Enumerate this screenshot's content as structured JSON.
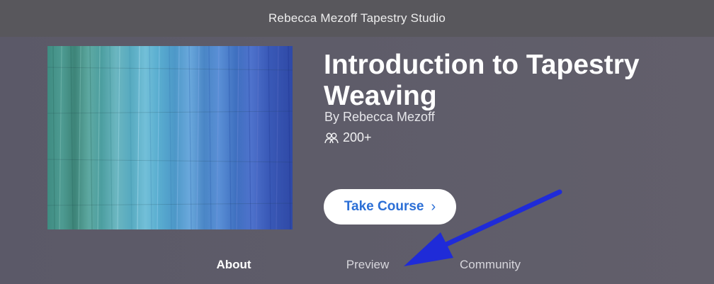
{
  "window": {
    "title": "Rebecca Mezoff Tapestry Studio"
  },
  "course": {
    "title": "Introduction to Tapestry Weaving",
    "author": "By Rebecca Mezoff",
    "participants_icon": "people-icon",
    "participants": "200+",
    "thumbnail": "dyed-yarn-skeins-image"
  },
  "actions": {
    "take_course_label": "Take Course",
    "take_course_icon": "chevron-right-icon"
  },
  "tabs": [
    {
      "label": "About",
      "active": true
    },
    {
      "label": "Preview",
      "active": false
    },
    {
      "label": "Community",
      "active": false
    }
  ],
  "annotation": {
    "icon": "arrow-pointer-icon",
    "color": "#1f2bd8",
    "points_to": "Preview"
  }
}
